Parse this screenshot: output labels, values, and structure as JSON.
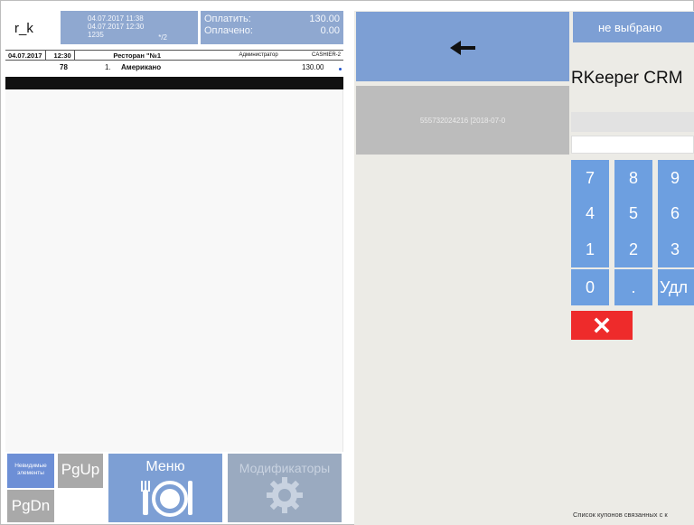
{
  "header": {
    "logo": "r_k",
    "open_time": "04.07.2017 11:38",
    "print_time": "04.07.2017 12:30",
    "order_num": "1235",
    "guests": "*/2",
    "pay_label": "Оплатить:",
    "pay_value": "130.00",
    "paid_label": "Оплачено:",
    "paid_value": "0.00"
  },
  "info": {
    "date": "04.07.2017",
    "time": "12:30",
    "restaurant": "Ресторан \"№1",
    "role": "Администратор",
    "cashier": "CASHIER-2"
  },
  "order": {
    "table": "78",
    "items": [
      {
        "num": "1.",
        "name": "Американо",
        "price": "130.00"
      }
    ]
  },
  "buttons": {
    "hidden_elements": "Невидимые элементы",
    "pgup": "PgUp",
    "pgdn": "PgDn",
    "menu": "Меню",
    "modifiers": "Модификаторы"
  },
  "right": {
    "coupon_code": "555732024216  [2018-07-0",
    "not_selected": "не выбрано",
    "title": "RKeeper CRM",
    "keypad": [
      [
        "7",
        "8",
        "9"
      ],
      [
        "4",
        "5",
        "6"
      ],
      [
        "1",
        "2",
        "3"
      ],
      [
        "0",
        ".",
        "Удл"
      ]
    ],
    "footer": "Список купонов связанных с к"
  },
  "colors": {
    "button_blue": "#7d9fd4",
    "key_blue": "#6d9fe0",
    "cancel_red": "#ee2b2b",
    "disabled_gray": "#a9a9a9"
  }
}
